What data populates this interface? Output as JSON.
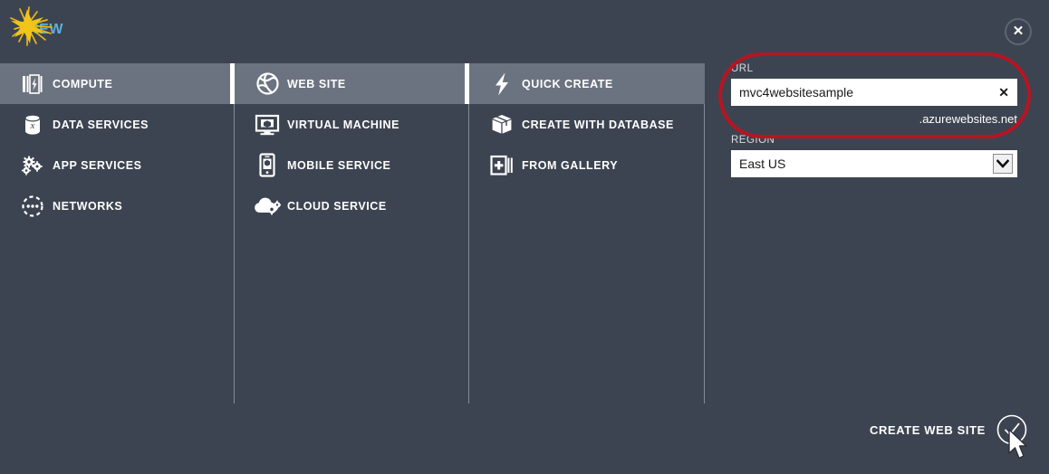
{
  "header": {
    "title": "NEW",
    "close_icon": "close-circle-icon"
  },
  "colors": {
    "background": "#3d4451",
    "selected_row": "#6c7380",
    "accent_title": "#5cb0dd",
    "annotation_red": "#b81421",
    "burst_gold": "#e8b816"
  },
  "columns": [
    {
      "name": "category",
      "items": [
        {
          "label": "COMPUTE",
          "icon": "server-rack-bolt-icon",
          "selected": true
        },
        {
          "label": "DATA SERVICES",
          "icon": "database-cylinder-icon",
          "selected": false
        },
        {
          "label": "APP SERVICES",
          "icon": "gears-icon",
          "selected": false
        },
        {
          "label": "NETWORKS",
          "icon": "dotted-circle-network-icon",
          "selected": false
        }
      ]
    },
    {
      "name": "service-type",
      "items": [
        {
          "label": "WEB SITE",
          "icon": "globe-icon",
          "selected": true
        },
        {
          "label": "VIRTUAL MACHINE",
          "icon": "monitor-icon",
          "selected": false
        },
        {
          "label": "MOBILE SERVICE",
          "icon": "phone-icon",
          "selected": false
        },
        {
          "label": "CLOUD SERVICE",
          "icon": "cloud-gears-icon",
          "selected": false
        }
      ]
    },
    {
      "name": "creation-mode",
      "items": [
        {
          "label": "QUICK CREATE",
          "icon": "lightning-bolt-icon",
          "selected": true
        },
        {
          "label": "CREATE WITH DATABASE",
          "icon": "box-package-icon",
          "selected": false
        },
        {
          "label": "FROM GALLERY",
          "icon": "plus-stack-icon",
          "selected": false
        }
      ]
    }
  ],
  "form": {
    "url": {
      "label": "URL",
      "value": "mvc4websitesample",
      "placeholder": "",
      "suffix": ".azurewebsites.net",
      "clear_icon": "close-x-icon"
    },
    "region": {
      "label": "REGION",
      "value": "East US",
      "options": [
        "East US"
      ],
      "arrow_icon": "chevron-down-icon"
    }
  },
  "footer": {
    "create_label": "CREATE WEB SITE",
    "check_icon": "checkmark-circle-icon",
    "cursor_icon": "mouse-pointer-icon",
    "burst_icon": "click-burst-icon"
  }
}
